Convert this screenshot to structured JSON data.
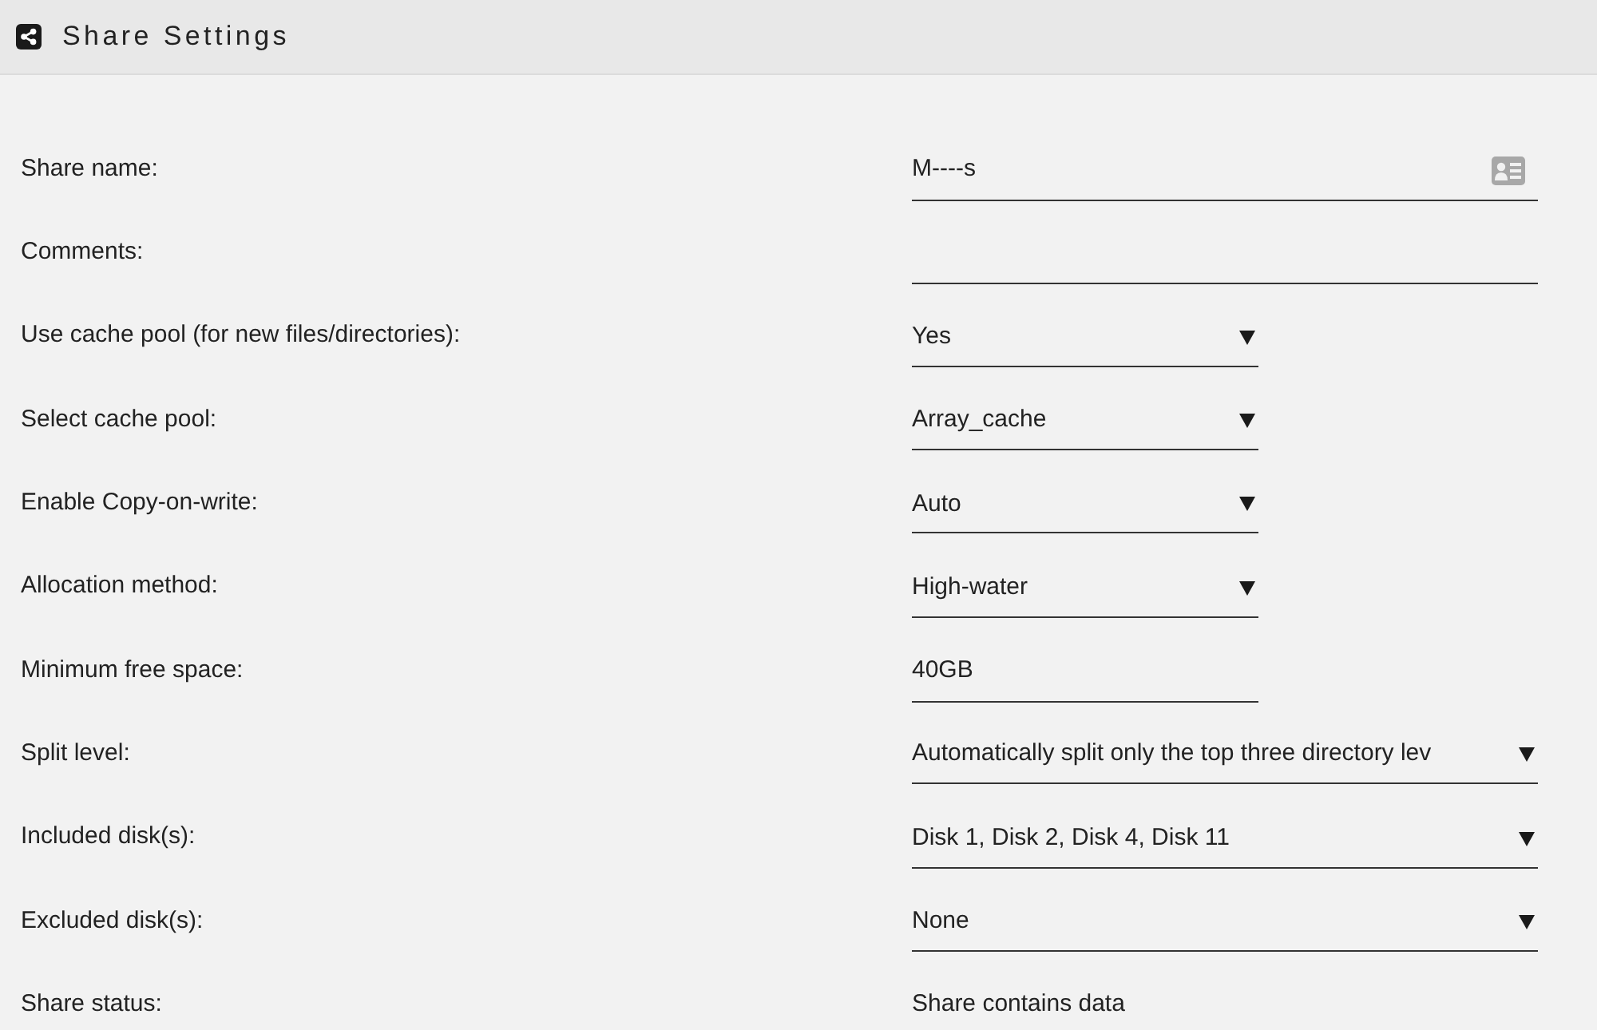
{
  "header": {
    "title": "Share Settings"
  },
  "fields": [
    {
      "label": "Share name:",
      "kind": "name",
      "value": "M----s",
      "wide": true
    },
    {
      "label": "Comments:",
      "kind": "text",
      "wide": true
    },
    {
      "label": "Use cache pool (for new files/directories):",
      "kind": "select",
      "value": "Yes",
      "wide": false
    },
    {
      "label": "Select cache pool:",
      "kind": "select",
      "value": "Array_cache",
      "wide": false
    },
    {
      "label": "Enable Copy-on-write:",
      "kind": "select",
      "value": "Auto",
      "wide": false
    },
    {
      "label": "Allocation method:",
      "kind": "select",
      "value": "High-water",
      "wide": false
    },
    {
      "label": "Minimum free space:",
      "kind": "text",
      "value": "40GB",
      "wide": false
    },
    {
      "label": "Split level:",
      "kind": "select",
      "value": "Automatically split only the top three directory lev",
      "wide": true
    },
    {
      "label": "Included disk(s):",
      "kind": "select",
      "value": "Disk 1, Disk 2, Disk 4, Disk 11",
      "wide": true
    },
    {
      "label": "Excluded disk(s):",
      "kind": "select",
      "value": "None",
      "wide": true
    },
    {
      "label": "Share status:",
      "kind": "status",
      "value": "Share contains data"
    }
  ]
}
